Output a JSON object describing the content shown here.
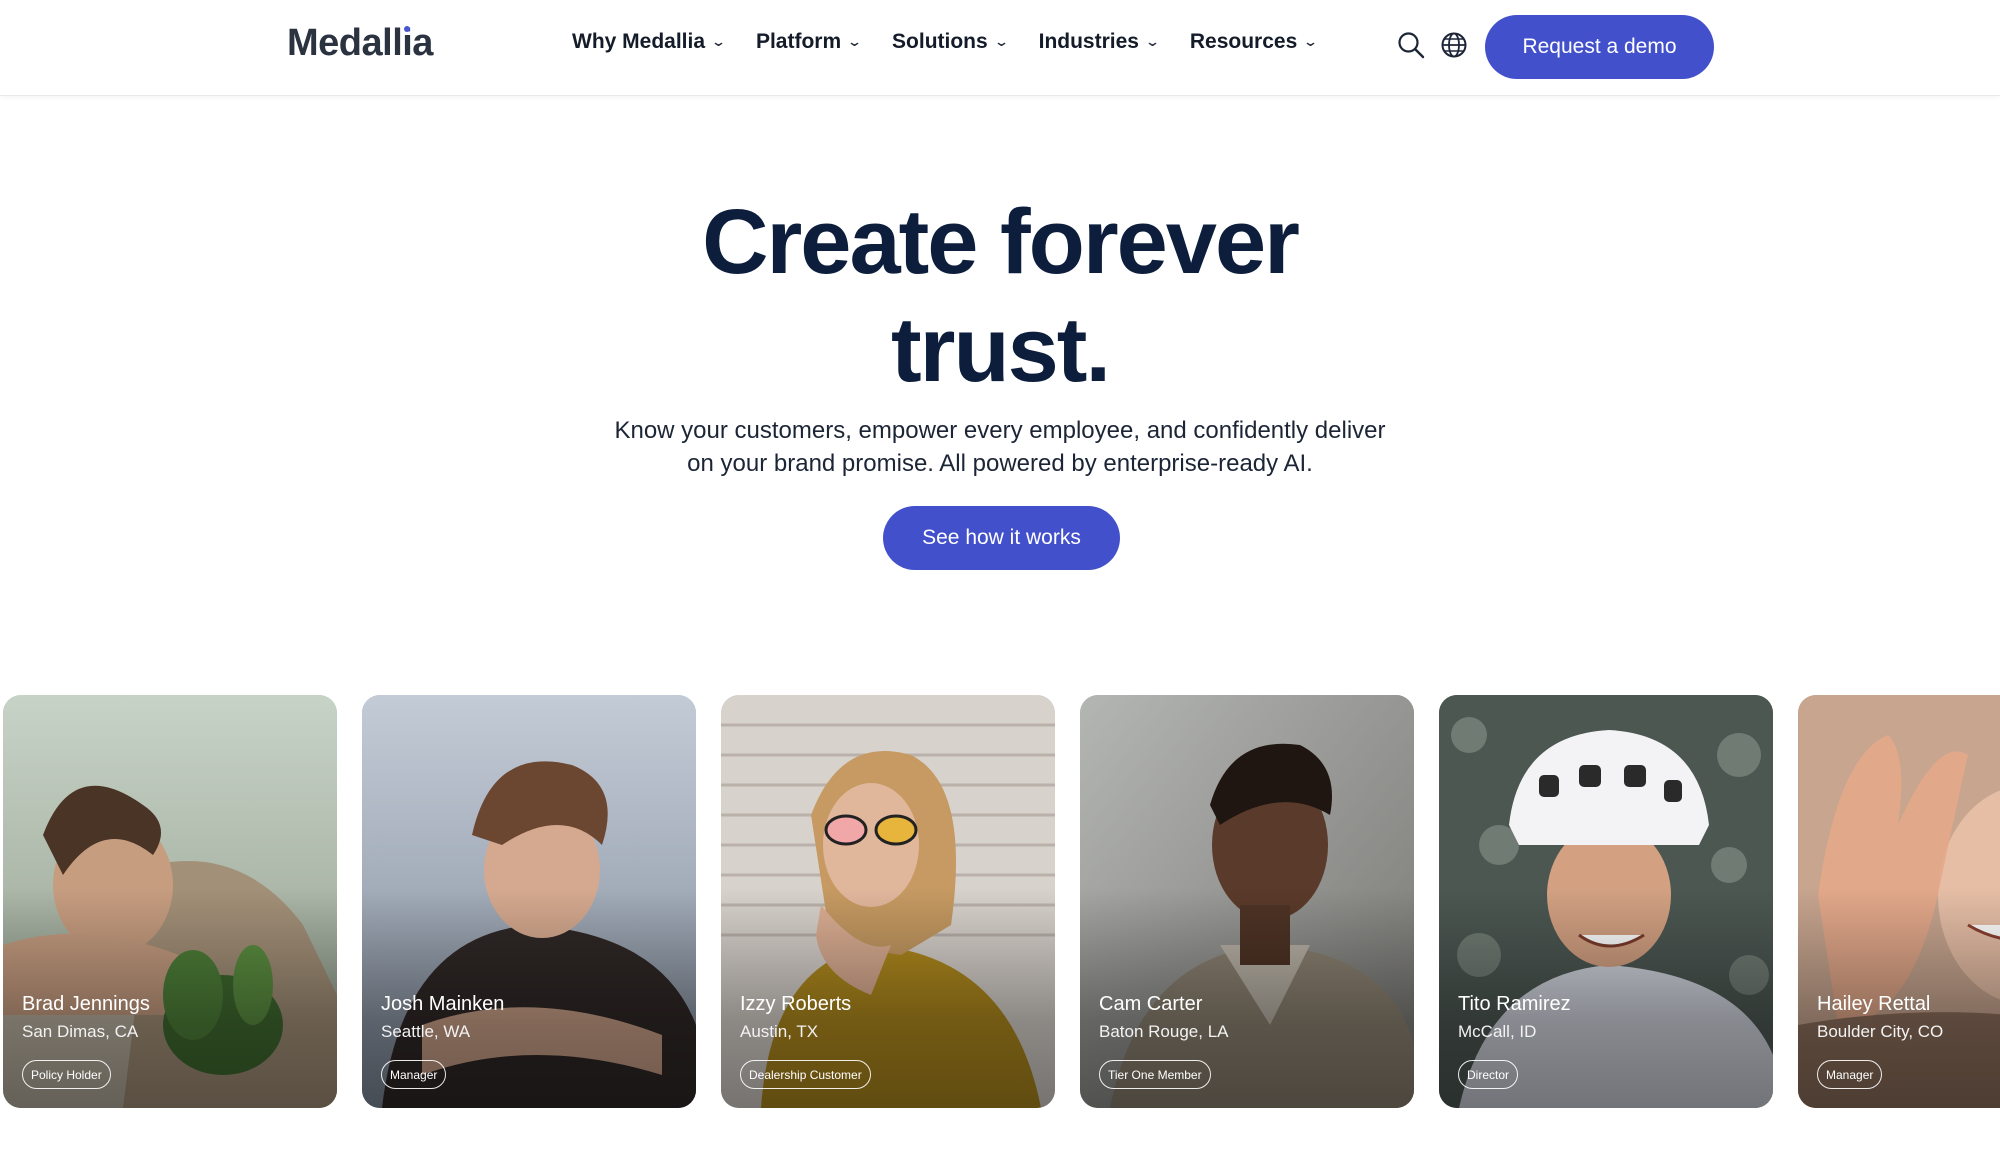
{
  "header": {
    "logo": "Medallia",
    "nav": [
      {
        "label": "Why Medallia"
      },
      {
        "label": "Platform"
      },
      {
        "label": "Solutions"
      },
      {
        "label": "Industries"
      },
      {
        "label": "Resources"
      }
    ],
    "search_icon": "search-icon",
    "globe_icon": "globe-icon",
    "cta": "Request a demo"
  },
  "hero": {
    "title_line1": "Create forever",
    "title_line2": "trust.",
    "subtitle_line1": "Know your customers, empower every employee, and confidently deliver",
    "subtitle_line2": "on your brand promise. All powered by enterprise-ready AI.",
    "cta": "See how it works"
  },
  "cards": [
    {
      "name": "Brad Jennings",
      "location": "San Dimas, CA",
      "tag": "Policy Holder"
    },
    {
      "name": "Josh Mainken",
      "location": "Seattle, WA",
      "tag": "Manager"
    },
    {
      "name": "Izzy Roberts",
      "location": "Austin, TX",
      "tag": "Dealership Customer"
    },
    {
      "name": "Cam Carter",
      "location": "Baton Rouge, LA",
      "tag": "Tier One Member"
    },
    {
      "name": "Tito Ramirez",
      "location": "McCall, ID",
      "tag": "Director"
    },
    {
      "name": "Hailey Rettal",
      "location": "Boulder City, CO",
      "tag": "Manager"
    }
  ],
  "colors": {
    "accent": "#4350cc",
    "heading": "#0c1e3c"
  }
}
